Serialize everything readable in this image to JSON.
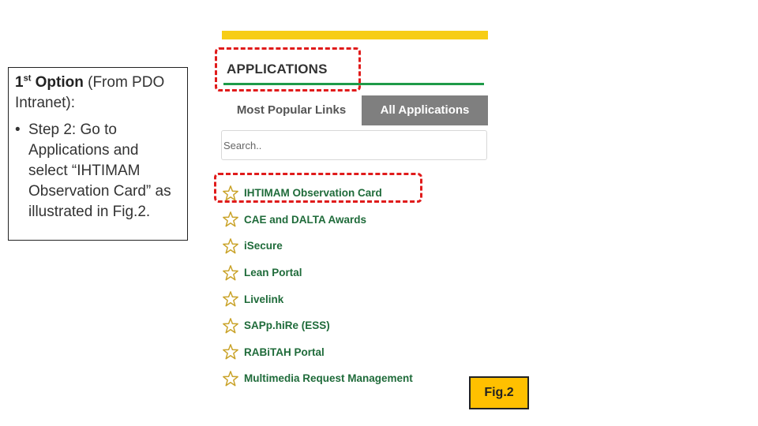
{
  "instruction": {
    "option_number": "1",
    "option_sup": "st",
    "option_word": "Option",
    "option_rest": " (From PDO Intranet):",
    "bullet": "•",
    "step_text": "Step 2: Go to Applications and select “IHTIMAM Observation Card” as illustrated in Fig.2."
  },
  "app": {
    "section_title": "APPLICATIONS",
    "tabs": {
      "popular": "Most Popular Links",
      "all": "All Applications"
    },
    "search": {
      "placeholder": "Search..",
      "value": ""
    },
    "items": [
      {
        "label": "IHTIMAM Observation Card",
        "icon": "star-icon"
      },
      {
        "label": "CAE and DALTA Awards",
        "icon": "star-icon"
      },
      {
        "label": "iSecure",
        "icon": "star-icon"
      },
      {
        "label": "Lean Portal",
        "icon": "star-icon"
      },
      {
        "label": "Livelink",
        "icon": "star-icon"
      },
      {
        "label": "SAPp.hiRe (ESS)",
        "icon": "star-icon"
      },
      {
        "label": "RABiTAH Portal",
        "icon": "star-icon"
      },
      {
        "label": "Multimedia Request Management",
        "icon": "star-icon"
      }
    ]
  },
  "figure_label": "Fig.2",
  "colors": {
    "top_bar": "#f7cd16",
    "green_rule": "#1e9b48",
    "active_tab": "#7f7f7f",
    "link_text": "#1f6b3a",
    "highlight": "#e01b1b",
    "fig_bg": "#ffc000"
  }
}
